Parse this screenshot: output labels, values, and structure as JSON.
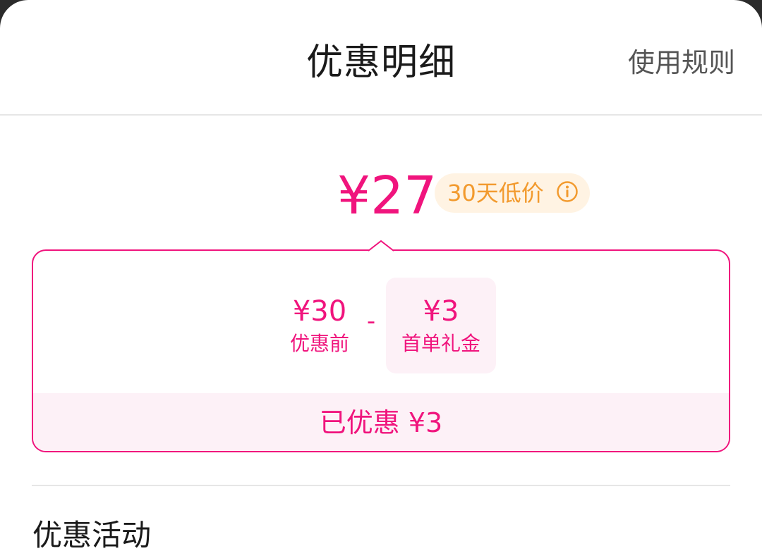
{
  "header": {
    "title": "优惠明细",
    "rules_link": "使用规则"
  },
  "price": {
    "final": "¥27",
    "badge_text": "30天低价",
    "badge_icon": "info-icon"
  },
  "breakdown": {
    "before_value": "¥30",
    "before_label": "优惠前",
    "operator": "-",
    "gift_value": "¥3",
    "gift_label": "首单礼金",
    "saved_text": "已优惠 ¥3"
  },
  "section": {
    "title": "优惠活动"
  },
  "colors": {
    "accent": "#f0147d",
    "accent_bg": "#fdf1f7",
    "badge_text": "#f29a2e",
    "badge_bg": "#fff3e3"
  }
}
